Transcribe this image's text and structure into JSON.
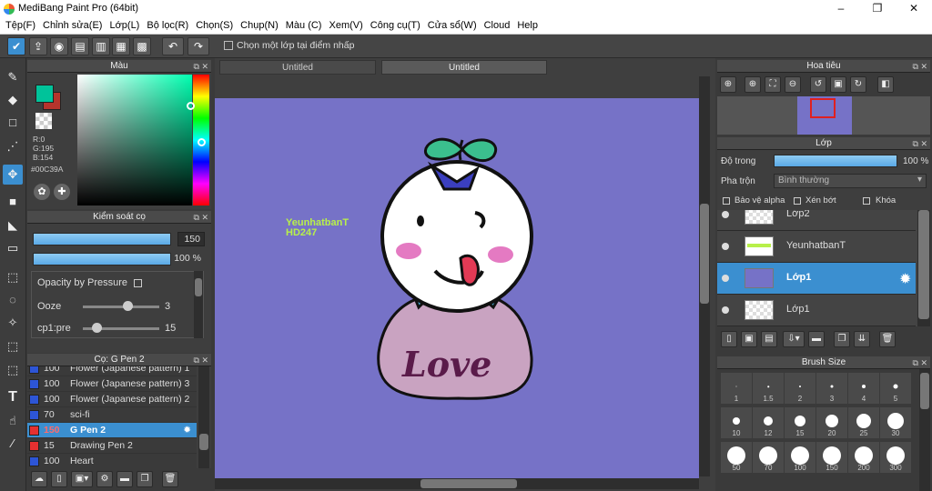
{
  "window": {
    "title": "MediBang Paint Pro (64bit)",
    "min": "–",
    "max": "❐",
    "close": "✕"
  },
  "menu": [
    "Tệp(F)",
    "Chỉnh sửa(E)",
    "Lớp(L)",
    "Bộ lọc(R)",
    "Chọn(S)",
    "Chụp(N)",
    "Màu (C)",
    "Xem(V)",
    "Công cụ(T)",
    "Cửa sổ(W)",
    "Cloud",
    "Help"
  ],
  "toolbar": {
    "option_label": "Chọn một lớp tại điểm nhấp",
    "buttons": [
      "check-icon",
      "export-icon",
      "comment-icon",
      "speech-icon",
      "page-icon",
      "grid-icon",
      "tile-icon",
      "undo-icon",
      "redo-icon"
    ]
  },
  "tabs": [
    {
      "label": "Untitled",
      "active": false
    },
    {
      "label": "Untitled",
      "active": true
    }
  ],
  "color_panel": {
    "title": "Màu",
    "r": "R:0",
    "g": "G:195",
    "b": "B:154",
    "hex": "#00C39A",
    "primary": "#00C39A",
    "secondary": "#b5342c"
  },
  "brush_control": {
    "title": "Kiểm soát cọ",
    "size": "150",
    "opacity": "100 %",
    "opacity_by_pressure": "Opacity by Pressure",
    "ooze_label": "Ooze",
    "ooze_value": "3",
    "cp_label": "cp1:pre",
    "cp_value": "15"
  },
  "brush_list": {
    "title": "Cọ: G Pen 2",
    "items": [
      {
        "size": "100",
        "name": "Flower (Japanese pattern) 1",
        "color": "#2d55d6",
        "selected": false
      },
      {
        "size": "100",
        "name": "Flower (Japanese pattern) 3",
        "color": "#2d55d6",
        "selected": false
      },
      {
        "size": "100",
        "name": "Flower (Japanese pattern) 2",
        "color": "#2d55d6",
        "selected": false
      },
      {
        "size": "70",
        "name": "sci-fi",
        "color": "#2d55d6",
        "selected": false
      },
      {
        "size": "150",
        "name": "G Pen 2",
        "color": "#e53030",
        "selected": true
      },
      {
        "size": "15",
        "name": "Drawing Pen 2",
        "color": "#e53030",
        "selected": false
      },
      {
        "size": "100",
        "name": "Heart",
        "color": "#2d55d6",
        "selected": false
      }
    ]
  },
  "canvas": {
    "watermark_line1": "YeunhatbanT",
    "watermark_line2": "HD247",
    "love_text": "Love"
  },
  "navigator": {
    "title": "Hoa tiêu"
  },
  "layers": {
    "title": "Lớp",
    "opacity_label": "Độ trong",
    "opacity_value": "100 %",
    "blend_label": "Pha trộn",
    "blend_value": "Bình thường",
    "protect_alpha": "Bảo vệ alpha",
    "clipping": "Xén bớt",
    "lock": "Khóa",
    "items": [
      {
        "name": "Lớp2",
        "selected": false
      },
      {
        "name": "YeunhatbanT",
        "selected": false
      },
      {
        "name": "Lớp1",
        "selected": true
      },
      {
        "name": "Lớp1",
        "selected": false
      }
    ]
  },
  "brush_size": {
    "title": "Brush Size",
    "row1": [
      "1",
      "1.5",
      "2",
      "3",
      "4",
      "5"
    ],
    "row2": [
      "10",
      "12",
      "15",
      "20",
      "25",
      "30"
    ],
    "row3": [
      "50",
      "70",
      "100",
      "150",
      "200",
      "300"
    ]
  }
}
